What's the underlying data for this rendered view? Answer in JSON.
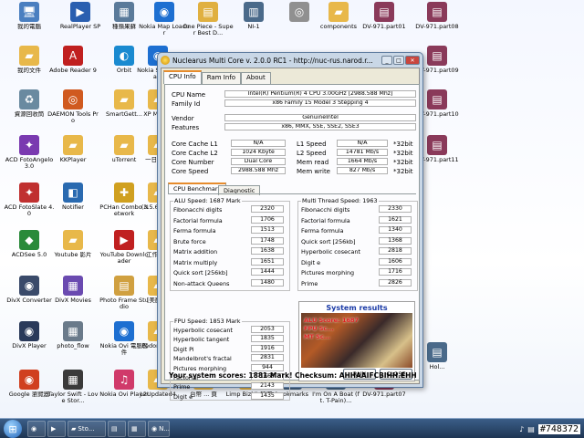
{
  "desktop": {
    "icons": [
      {
        "label": "我的電腦",
        "glyph": "🖥",
        "color": "#4a7fc0"
      },
      {
        "label": "RealPlayer SP",
        "glyph": "▶",
        "color": "#2a5fb0"
      },
      {
        "label": "種蘋果蘇",
        "glyph": "▦",
        "color": "#5a7a9a"
      },
      {
        "label": "Nokia Map Loader",
        "glyph": "◉",
        "color": "#1d6fd1"
      },
      {
        "label": "One Piece - Super Best D...",
        "glyph": "▤",
        "color": "#e0b040"
      },
      {
        "label": "NI-1",
        "glyph": "▥",
        "color": "#4a6a8a"
      },
      {
        "label": "",
        "glyph": "◎",
        "color": "#909090"
      },
      {
        "label": "components",
        "glyph": "▰",
        "color": "#e8b84a"
      },
      {
        "label": "DV-971.part01",
        "glyph": "▤",
        "color": "#8a3a5a"
      },
      {
        "label": "DV-971.part08",
        "glyph": "▤",
        "color": "#8a3a5a"
      },
      {
        "label": "我的文件",
        "glyph": "▰",
        "color": "#e8b84a"
      },
      {
        "label": "Adobe Reader 9",
        "glyph": "A",
        "color": "#c02020"
      },
      {
        "label": "Orbit",
        "glyph": "◐",
        "color": "#1a8ad0"
      },
      {
        "label": "Nokia S... Upda...",
        "glyph": "◉",
        "color": "#1d6fd1"
      },
      {
        "label": "DV-971.part09",
        "glyph": "▤",
        "color": "#8a3a5a"
      },
      {
        "label": "資源回收筒",
        "glyph": "♻",
        "color": "#6a8aa0"
      },
      {
        "label": "DAEMON Tools Pro",
        "glyph": "◎",
        "color": "#d05a20"
      },
      {
        "label": "SmartGett...",
        "glyph": "▰",
        "color": "#e8b84a"
      },
      {
        "label": "XP MGA...",
        "glyph": "▰",
        "color": "#e8b84a"
      },
      {
        "label": "DV-971.part10",
        "glyph": "▤",
        "color": "#8a3a5a"
      },
      {
        "label": "ACD FotoAngelo 3.0",
        "glyph": "✦",
        "color": "#7a3ab0"
      },
      {
        "label": "KKPlayer",
        "glyph": "▰",
        "color": "#e8b84a"
      },
      {
        "label": "uTorrent",
        "glyph": "▰",
        "color": "#e8b84a"
      },
      {
        "label": "一日 前...",
        "glyph": "▰",
        "color": "#e8b84a"
      },
      {
        "label": "DV-971.part11",
        "glyph": "▤",
        "color": "#8a3a5a"
      },
      {
        "label": "ACD FotoSlate 4.0",
        "glyph": "✦",
        "color": "#c03030"
      },
      {
        "label": "Notifier",
        "glyph": "◧",
        "color": "#2a6ab0"
      },
      {
        "label": "PCHan Combo Network",
        "glyph": "✚",
        "color": "#d0a020"
      },
      {
        "label": "(3.5.6) Ni...",
        "glyph": "▰",
        "color": "#e8b84a"
      },
      {
        "label": "ACDSee 5.0",
        "glyph": "◆",
        "color": "#2a8a3a"
      },
      {
        "label": "Youtube 影片",
        "glyph": "▰",
        "color": "#e8b84a"
      },
      {
        "label": "YouTube Downloader",
        "glyph": "▶",
        "color": "#c02020"
      },
      {
        "label": "工作室...",
        "glyph": "▰",
        "color": "#e8b84a"
      },
      {
        "label": "DivX Converter",
        "glyph": "◉",
        "color": "#3a4a6a"
      },
      {
        "label": "DivX Movies",
        "glyph": "▦",
        "color": "#6a4ab0"
      },
      {
        "label": "Photo Frame Studio",
        "glyph": "▤",
        "color": "#d0a040"
      },
      {
        "label": "[美顏]...",
        "glyph": "▰",
        "color": "#e8b84a"
      },
      {
        "label": "DivX Player",
        "glyph": "◉",
        "color": "#2a3a5a"
      },
      {
        "label": "photo_flow",
        "glyph": "▦",
        "color": "#6a7a8a"
      },
      {
        "label": "Nokia Ovi 電腦套件",
        "glyph": "◉",
        "color": "#1d6fd1"
      },
      {
        "label": "Pedometer",
        "glyph": "▰",
        "color": "#e8b84a"
      },
      {
        "label": "Google 瀏覽器",
        "glyph": "◉",
        "color": "#d04020"
      },
      {
        "label": "Taylor Swift - Love Stor...",
        "glyph": "▦",
        "color": "#3a3a3a"
      },
      {
        "label": "Nokia Ovi Player",
        "glyph": "♫",
        "color": "#d03a6a"
      },
      {
        "label": "L2Updated4",
        "glyph": "▰",
        "color": "#e8b84a"
      },
      {
        "label": "台幣 ... 頁",
        "glyph": "▰",
        "color": "#e8b84a"
      },
      {
        "label": "Limp Bizkit 精選",
        "glyph": "▰",
        "color": "#e8b84a"
      },
      {
        "label": "bookmarks",
        "glyph": "▤",
        "color": "#4a6a8a"
      },
      {
        "label": "I'm On A Boat (ft. T-Pain)...",
        "glyph": "▤",
        "color": "#4a6a8a"
      },
      {
        "label": "DV-971.part07",
        "glyph": "▤",
        "color": "#8a3a5a"
      },
      {
        "label": "Hol...",
        "glyph": "▤",
        "color": "#4a6a8a"
      }
    ]
  },
  "taskbar": {
    "start": "⊞",
    "buttons": [
      {
        "label": "",
        "glyph": "◉"
      },
      {
        "label": "",
        "glyph": "▶"
      },
      {
        "label": "Sto...",
        "glyph": "▰"
      },
      {
        "label": "",
        "glyph": "▤"
      },
      {
        "label": "",
        "glyph": "▦"
      },
      {
        "label": "N...",
        "glyph": "◉"
      }
    ],
    "tray_watermark": "#748372"
  },
  "window": {
    "title": "Nuclearus Multi Core  v. 2.0.0  RC1  -  http://nuc-rus.narod.r...",
    "tabs": [
      "CPU Info",
      "Ram Info",
      "About"
    ],
    "cpu": {
      "cpu_name_label": "CPU Name",
      "cpu_name": "Intel(R) Pentium(R) 4 CPU 3.00GHz [2988.588 Mhz]",
      "family_label": "Family Id",
      "family": "x86 Family 15 Model 3 Stepping 4",
      "vendor_label": "Vendor",
      "vendor": "GenuineIntel",
      "features_label": "Features",
      "features": "x86, MMX, SSE, SSE2, SSE3",
      "l1c_label": "Core Cache L1",
      "l1c": "N/A",
      "l2c_label": "Core Cache L2",
      "l2c": "1024 Kbyte",
      "cores_label": "Core Number",
      "cores": "Dual Core",
      "speed_label": "Core Speed",
      "speed": "2988.588 Mhz",
      "l1s_label": "L1 Speed",
      "l1s": "N/A",
      "l1s_bit": "*32bit",
      "l2s_label": "L2 Speed",
      "l2s": "14781 Mb/s",
      "l2s_bit": "*32bit",
      "mread_label": "Mem read",
      "mread": "1664 Mb/s",
      "mread_bit": "*32bit",
      "mwrite_label": "Mem write",
      "mwrite": "827 Mb/s",
      "mwrite_bit": "*32bit"
    },
    "subtabs": [
      "CPU Benchmark",
      "Diagnostic"
    ],
    "alu": {
      "title": "ALU Speed: 1687 Mark",
      "rows": [
        {
          "name": "Fibonacchi digits",
          "value": "2320"
        },
        {
          "name": "Factorial formula",
          "value": "1706"
        },
        {
          "name": "Ferma formula",
          "value": "1513"
        },
        {
          "name": "Brute force",
          "value": "1748"
        },
        {
          "name": "Matrix addition",
          "value": "1638"
        },
        {
          "name": "Matrix multiply",
          "value": "1651"
        },
        {
          "name": "Quick sort [256kb]",
          "value": "1444"
        },
        {
          "name": "Non-attack Queens",
          "value": "1480"
        }
      ]
    },
    "mt": {
      "title": "Multi Thread Speed: 1963",
      "rows": [
        {
          "name": "Fibonacchi digits",
          "value": "2330"
        },
        {
          "name": "Factorial formula",
          "value": "1621"
        },
        {
          "name": "Ferma formula",
          "value": "1340"
        },
        {
          "name": "Quick sort [256kb]",
          "value": "1368"
        },
        {
          "name": "Hyperbolic cosecant",
          "value": "2818"
        },
        {
          "name": "Digit e",
          "value": "1606"
        },
        {
          "name": "Pictures morphing",
          "value": "1716"
        },
        {
          "name": "Prime",
          "value": "2826"
        }
      ]
    },
    "fpu": {
      "title": "FPU Speed: 1853 Mark",
      "rows": [
        {
          "name": "Hyperbolic cosecant",
          "value": "2053"
        },
        {
          "name": "Hyperbolic tangent",
          "value": "1835"
        },
        {
          "name": "Digit Pi",
          "value": "1916"
        },
        {
          "name": "Mandelbrot's fractal",
          "value": "2831"
        },
        {
          "name": "Pictures morphing",
          "value": "944"
        },
        {
          "name": "Factorial",
          "value": "1668"
        },
        {
          "name": "Prime",
          "value": "2143"
        },
        {
          "name": "Digit e",
          "value": "1435"
        }
      ]
    },
    "results": {
      "title": "System results",
      "alu": "ALU Score: 1687",
      "fpu": "FPU Sc...",
      "mt": "MT Sc...",
      "run": "RUN",
      "close": "CLOSE"
    },
    "status": "Your system scores: 1881 Mark!   Checksum: AHHAAIFCBIHH.EHH"
  }
}
